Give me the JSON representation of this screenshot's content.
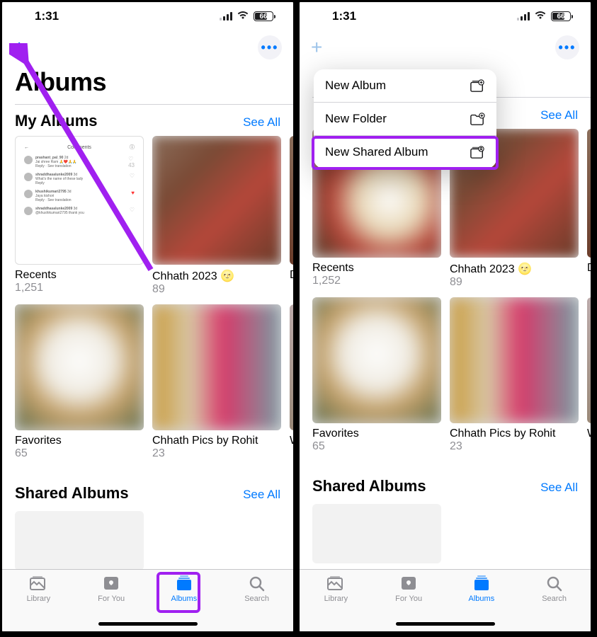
{
  "left": {
    "status": {
      "time": "1:31",
      "battery": "66"
    },
    "page_title": "Albums",
    "sections": {
      "my_albums": {
        "title": "My Albums",
        "see_all": "See All"
      },
      "shared": {
        "title": "Shared Albums",
        "see_all": "See All"
      }
    },
    "albums_row1": [
      {
        "name": "Recents",
        "count": "1,251"
      },
      {
        "name": "Chhath 2023 🌝",
        "count": "89"
      },
      {
        "name": "D",
        "count": ""
      }
    ],
    "albums_row2": [
      {
        "name": "Favorites",
        "count": "65"
      },
      {
        "name": "Chhath Pics by Rohit",
        "count": "23"
      },
      {
        "name": "W",
        "count": ""
      }
    ],
    "tabs": {
      "library": "Library",
      "foryou": "For You",
      "albums": "Albums",
      "search": "Search"
    }
  },
  "right": {
    "status": {
      "time": "1:31",
      "battery": "66"
    },
    "popup": {
      "new_album": "New Album",
      "new_folder": "New Folder",
      "new_shared_album": "New Shared Album"
    },
    "sections": {
      "my_albums": {
        "see_all": "See All"
      },
      "shared": {
        "title": "Shared Albums",
        "see_all": "See All"
      }
    },
    "albums_row1": [
      {
        "name": "Recents",
        "count": "1,252"
      },
      {
        "name": "Chhath 2023 🌝",
        "count": "89"
      },
      {
        "name": "D",
        "count": ""
      }
    ],
    "albums_row2": [
      {
        "name": "Favorites",
        "count": "65"
      },
      {
        "name": "Chhath Pics by Rohit",
        "count": "23"
      },
      {
        "name": "W",
        "count": ""
      }
    ],
    "tabs": {
      "library": "Library",
      "foryou": "For You",
      "albums": "Albums",
      "search": "Search"
    }
  }
}
